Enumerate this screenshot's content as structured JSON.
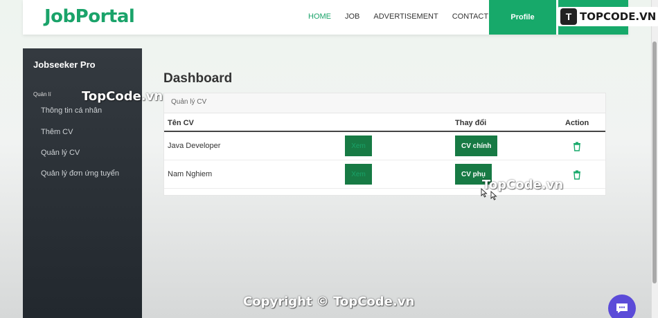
{
  "nav": {
    "brand": "JobPortal",
    "links": [
      "HOME",
      "JOB",
      "ADVERTISEMENT",
      "CONTACT"
    ],
    "profile_label": "Profile",
    "watermark_icon": "T",
    "watermark_text": "TOPCODE.VN"
  },
  "sidebar": {
    "title": "Jobseeker Pro",
    "section": "Quản lí",
    "items": [
      "Thông tin cá nhân",
      "Thêm CV",
      "Quản lý CV",
      "Quản lý đơn ứng tuyển"
    ]
  },
  "main": {
    "title": "Dashboard",
    "card_header": "Quản lý CV",
    "columns": [
      "Tên CV",
      "Thay đổi",
      "Action"
    ],
    "rows": [
      {
        "name": "Java Developer",
        "view_label": "Xem",
        "cv_label": "CV chính"
      },
      {
        "name": "Nam Nghiem",
        "view_label": "Xem",
        "cv_label": "CV phụ"
      }
    ]
  },
  "overlays": {
    "topcode_1": "TopCode.vn",
    "topcode_2": "TopCode.vn",
    "copyright": "Copyright © TopCode.vn"
  },
  "colors": {
    "accent": "#17a96a",
    "button_dark": "#177a44",
    "sidebar_bg": "#343a40",
    "chat": "#5b4bd8"
  }
}
